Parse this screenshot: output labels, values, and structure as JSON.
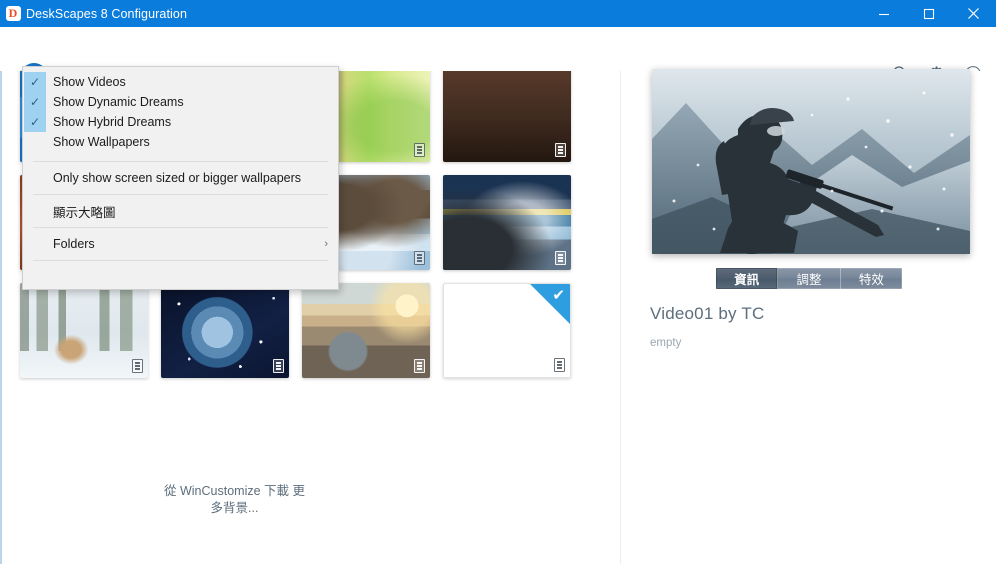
{
  "window": {
    "title": "DeskScapes 8 Configuration",
    "app_icon": "deskscapes-logo-icon",
    "logo_letter": "D",
    "controls": {
      "minimize": "minimize-icon",
      "maximize": "maximize-icon",
      "close": "close-icon"
    },
    "titlebar_color": "#0a7cdb"
  },
  "toolbar": {
    "filter_button": "filter-view-button",
    "filter_caret": "chevron-down-icon",
    "icons": [
      {
        "name": "search-icon",
        "title": "Search"
      },
      {
        "name": "gear-icon",
        "title": "Settings"
      },
      {
        "name": "help-icon",
        "title": "Help"
      }
    ]
  },
  "menu": {
    "items": [
      {
        "label": "Show Videos",
        "checked": true,
        "type": "check"
      },
      {
        "label": "Show Dynamic Dreams",
        "checked": true,
        "type": "check"
      },
      {
        "label": "Show Hybrid Dreams",
        "checked": true,
        "type": "check"
      },
      {
        "label": "Show Wallpapers",
        "checked": false,
        "type": "check"
      },
      {
        "type": "separator"
      },
      {
        "label": "Only show screen sized or bigger wallpapers",
        "checked": false,
        "type": "item"
      },
      {
        "type": "separator"
      },
      {
        "label": "顯示大略圖",
        "checked": false,
        "type": "item"
      },
      {
        "type": "separator"
      },
      {
        "label": "Folders",
        "checked": false,
        "type": "submenu",
        "chevron": "chevron-right-icon"
      },
      {
        "type": "separator"
      },
      {
        "label": "從 WinCustomize 下載更多背景...",
        "checked": false,
        "type": "item"
      }
    ]
  },
  "gallery": {
    "thumbnails": [
      {
        "name": "thumb-blue-swirl",
        "badge": "film-icon",
        "badge_dark": false
      },
      {
        "name": "thumb-blue-circles",
        "badge": "film-icon",
        "badge_dark": false
      },
      {
        "name": "thumb-tree-bark-green",
        "badge": "film-icon",
        "badge_dark": true
      },
      {
        "name": "thumb-wood-dark",
        "badge": "film-icon",
        "badge_dark": false
      },
      {
        "name": "thumb-autumn-red",
        "badge": "film-icon",
        "badge_dark": false
      },
      {
        "name": "thumb-night-sky-stars",
        "badge": "film-icon",
        "badge_dark": false
      },
      {
        "name": "thumb-rocky-coast-waves",
        "badge": "film-icon",
        "badge_dark": true
      },
      {
        "name": "thumb-stormy-sea-sunset",
        "badge": "film-icon",
        "badge_dark": false
      },
      {
        "name": "thumb-snow-forest-tiger",
        "badge": "film-icon",
        "badge_dark": true
      },
      {
        "name": "thumb-planet-space",
        "badge": "film-icon",
        "badge_dark": false
      },
      {
        "name": "thumb-crystal-ball-sunset",
        "badge": "film-icon",
        "badge_dark": false
      }
    ],
    "download_tile": {
      "name": "download-more-tile",
      "badge": "film-icon",
      "check": "✔",
      "label": "從 WinCustomize 下載\n更多背景..."
    }
  },
  "preview": {
    "image_name": "soldier-sniper-snow-preview",
    "tabs": [
      {
        "label": "資訊",
        "active": true
      },
      {
        "label": "調整",
        "active": false
      },
      {
        "label": "特效",
        "active": false
      }
    ],
    "video_title": "Video01 by TC",
    "video_description": "empty"
  },
  "colors": {
    "accent": "#0a7cdb",
    "filter_blue": "#1567b4",
    "tab_active": "#4e5c6d",
    "menu_bg": "#f1f1f1",
    "check_highlight": "#9fd1f0",
    "download_corner": "#2f9ee0",
    "text_muted": "#9aa6b0",
    "title_text": "#5d6e7c"
  }
}
